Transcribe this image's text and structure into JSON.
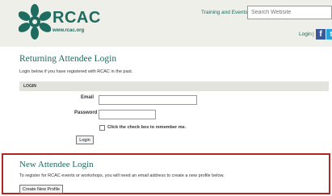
{
  "header": {
    "logo_text": "RCAC",
    "logo_url": "www.rcac.org",
    "nav_training": "Training and Events",
    "search_placeholder": "Search Website",
    "login_link": "Login",
    "separator": "|",
    "facebook_glyph": "f",
    "twitter_glyph": "t"
  },
  "returning": {
    "title": "Returning Attendee Login",
    "subtitle": "Login below if you have registered with RCAC in the past.",
    "bar_label": "LOGIN",
    "email_label": "Email",
    "password_label": "Password",
    "remember_label": "Click the check box to remember me.",
    "login_button": "Login"
  },
  "new_attendee": {
    "title": "New Attendee Login",
    "subtitle": "To register for RCAC events or workshops, you will need an email address to create a new profile below.",
    "create_button": "Create New Profile"
  },
  "colors": {
    "brand_green": "#1e6b5f",
    "highlight_red": "#b42323",
    "header_bg": "#efefe9",
    "facebook_blue": "#3b5998",
    "twitter_blue": "#2aa1d8"
  }
}
